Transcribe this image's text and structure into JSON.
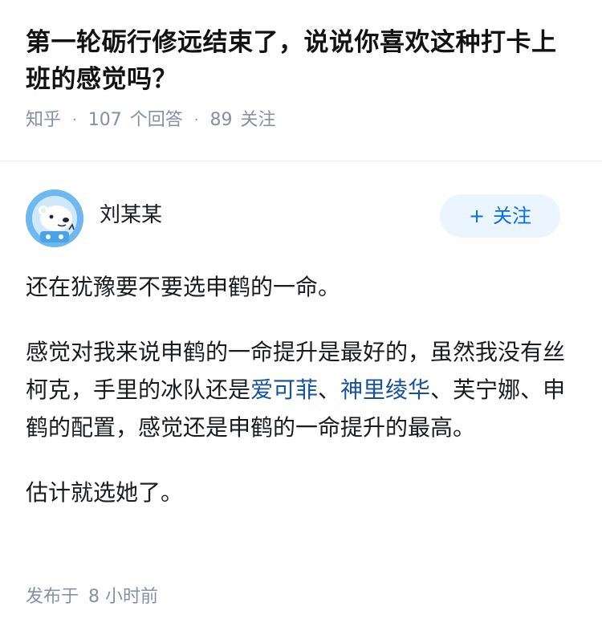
{
  "question": {
    "title": "第一轮砺行修远结束了，说说你喜欢这种打卡上班的感觉吗？",
    "source": "知乎",
    "answer_count": "107",
    "answer_label": "个回答",
    "follower_count": "89",
    "follower_label": "关注"
  },
  "author": {
    "name": "刘某某",
    "avatar_icon": "polar-bear-astronaut-icon",
    "follow_label": "关注",
    "follow_icon": "plus-icon"
  },
  "answer": {
    "p1": "还在犹豫要不要选申鹤的一命。",
    "p2_part1": "感觉对我来说申鹤的一命提升是最好的，虽然我没有丝柯克，手里的冰队还是",
    "p2_link1": "爱可菲",
    "p2_sep1": "、",
    "p2_link2": "神里绫华",
    "p2_part2": "、芙宁娜、申鹤的配置，感觉还是申鹤的一命提升的最高。",
    "p3": "估计就选她了。"
  },
  "publish": {
    "label": "发布于",
    "time": "8 小时前"
  },
  "colors": {
    "link": "#175199",
    "follow_text": "#056de8",
    "follow_bg": "#ebf5ff",
    "meta": "#8590a6"
  }
}
